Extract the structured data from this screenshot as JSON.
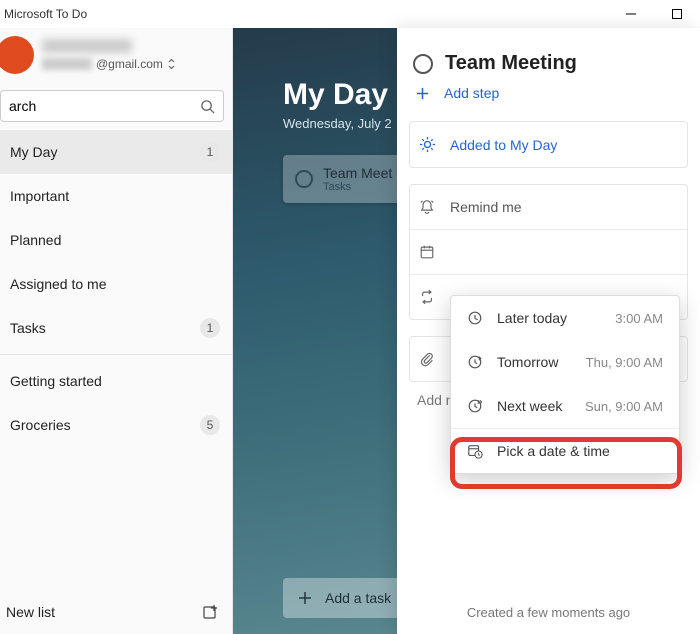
{
  "window": {
    "title": "Microsoft To Do"
  },
  "account": {
    "email_suffix": "@gmail.com"
  },
  "search": {
    "placeholder": "Search"
  },
  "sidebar": {
    "items": [
      {
        "label": "My Day",
        "count": "1"
      },
      {
        "label": "Important",
        "count": ""
      },
      {
        "label": "Planned",
        "count": ""
      },
      {
        "label": "Assigned to me",
        "count": ""
      },
      {
        "label": "Tasks",
        "count": "1"
      }
    ],
    "lists": [
      {
        "label": "Getting started",
        "count": ""
      },
      {
        "label": "Groceries",
        "count": "5"
      }
    ],
    "new_list": "New list"
  },
  "main": {
    "heading": "My Day",
    "date": "Wednesday, July 2",
    "task": {
      "title": "Team Meet",
      "subtitle": "Tasks"
    },
    "add_task": "Add a task"
  },
  "detail": {
    "title": "Team Meeting",
    "add_step": "Add step",
    "added_my_day": "Added to My Day",
    "remind_me": "Remind me",
    "add_note": "Add note",
    "created": "Created a few moments ago"
  },
  "popup": {
    "opt1": {
      "label": "Later today",
      "time": "3:00 AM"
    },
    "opt2": {
      "label": "Tomorrow",
      "time": "Thu, 9:00 AM"
    },
    "opt3": {
      "label": "Next week",
      "time": "Sun, 9:00 AM"
    },
    "opt4": {
      "label": "Pick a date & time"
    }
  }
}
